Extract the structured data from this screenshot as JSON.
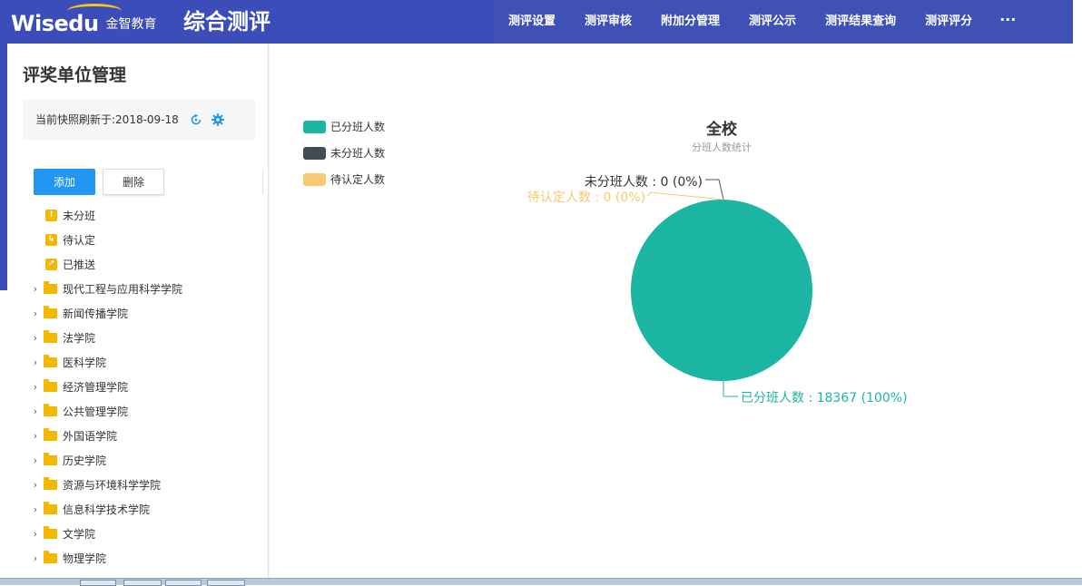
{
  "header": {
    "logo_text": "Wisedu",
    "logo_cn": "金智教育",
    "app_title": "综合测评",
    "nav": [
      "测评设置",
      "测评审核",
      "附加分管理",
      "测评公示",
      "测评结果查询",
      "测评评分"
    ],
    "more": "···"
  },
  "sidebar": {
    "title": "评奖单位管理",
    "snapshot": "当前快照刷新于:2018-09-18",
    "add_label": "添加",
    "delete_label": "删除",
    "status_items": [
      {
        "label": "未分班",
        "glyph": "!"
      },
      {
        "label": "待认定",
        "glyph": "↳"
      },
      {
        "label": "已推送",
        "glyph": "↗"
      }
    ],
    "folders": [
      "现代工程与应用科学学院",
      "新闻传播学院",
      "法学院",
      "医科学院",
      "经济管理学院",
      "公共管理学院",
      "外国语学院",
      "历史学院",
      "资源与环境科学学院",
      "信息科学技术学院",
      "文学院",
      "物理学院"
    ]
  },
  "colors": {
    "assigned": "#1cb5a4",
    "unassigned": "#434b57",
    "pending": "#f7c972",
    "nav_bg": "#3f51b5",
    "primary": "#2196f3"
  },
  "chart_data": {
    "type": "pie",
    "title": "全校",
    "subtitle": "分班人数统计",
    "legend_position": "top-left",
    "slices": [
      {
        "name": "已分班人数",
        "value": 18367,
        "percent": "100%",
        "label": "已分班人数 : 18367 (100%)"
      },
      {
        "name": "未分班人数",
        "value": 0,
        "percent": "0%",
        "label": "未分班人数 : 0 (0%)"
      },
      {
        "name": "待认定人数",
        "value": 0,
        "percent": "0%",
        "label": "待认定人数 : 0 (0%)"
      }
    ]
  }
}
